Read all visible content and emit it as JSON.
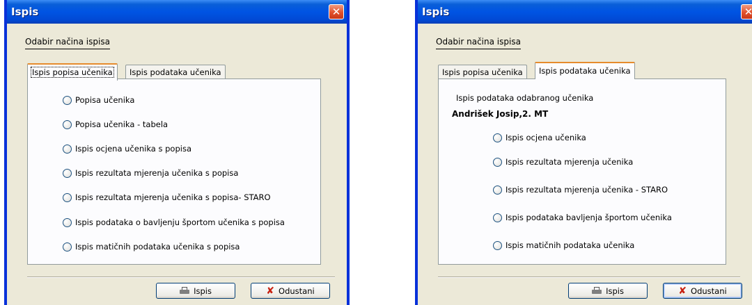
{
  "left_window": {
    "title": "Ispis",
    "group_label": "Odabir načina ispisa",
    "tabs": [
      {
        "label": "Ispis popisa učenika",
        "active": true
      },
      {
        "label": "Ispis podataka učenika",
        "active": false
      }
    ],
    "options": [
      "Popisa učenika",
      "Popisa učenika - tabela",
      "Ispis ocjena učenika s popisa",
      "Ispis rezultata mjerenja učenika s popisa",
      "Ispis rezultata mjerenja učenika s popisa- STARO",
      "Ispis podataka o bavljenju športom učenika s popisa",
      "Ispis matičnih podataka učenika s popisa"
    ],
    "print_label": "Ispis",
    "cancel_label": "Odustani"
  },
  "right_window": {
    "title": "Ispis",
    "group_label": "Odabir načina ispisa",
    "tabs": [
      {
        "label": "Ispis popisa učenika",
        "active": false
      },
      {
        "label": "Ispis podataka učenika",
        "active": true
      }
    ],
    "info_text": "Ispis podataka odabranog učenika",
    "student_name": "Andrišek Josip,2. MT",
    "options": [
      "Ispis ocjena učenika",
      "Ispis rezultata mjerenja učenika",
      "Ispis rezultata mjerenja učenika - STARO",
      "Ispis podataka bavljenja športom učenika",
      "Ispis matičnih podataka učenika"
    ],
    "print_label": "Ispis",
    "cancel_label": "Odustani"
  },
  "colors": {
    "titlebar": "#0054e3",
    "window_bg": "#ece9d8",
    "panel_bg": "#fcfcfe",
    "close_button": "#e2502c",
    "active_tab_accent": "#e68b2c",
    "cancel_icon": "#c82010"
  },
  "icons": {
    "close": "close-icon",
    "print": "printer-icon",
    "cancel": "x-icon",
    "radio": "radio-button"
  }
}
